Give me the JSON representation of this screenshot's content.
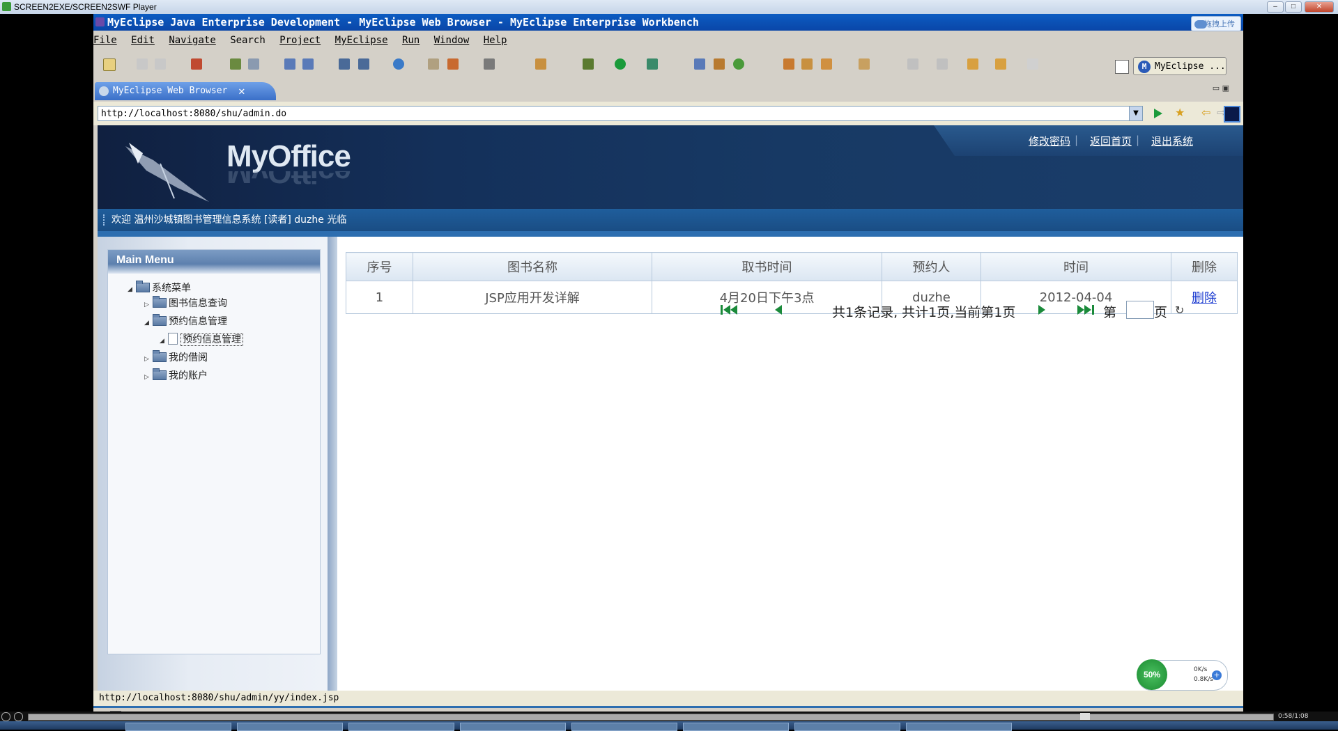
{
  "player": {
    "title": "SCREEN2EXE/SCREEN2SWF Player",
    "time": "0:58/1:08"
  },
  "eclipse": {
    "title": "MyEclipse Java Enterprise Development - MyEclipse Web Browser - MyEclipse Enterprise Workbench",
    "upload_label": "拖拽上传",
    "menus": [
      "File",
      "Edit",
      "Navigate",
      "Search",
      "Project",
      "MyEclipse",
      "Run",
      "Window",
      "Help"
    ],
    "perspective": "MyEclipse ...",
    "perspective_icon_letter": "M",
    "tab_label": "MyEclipse Web Browser",
    "url": "http://localhost:8080/shu/admin.do",
    "status_url": "http://localhost:8080/shu/admin/yy/index.jsp"
  },
  "site": {
    "logo": "MyOffice",
    "top_links": [
      "修改密码",
      "返回首页",
      "退出系统"
    ],
    "welcome": "欢迎 温州沙城镇图书管理信息系统 [读者] duzhe 光临"
  },
  "sidebar": {
    "title": "Main Menu",
    "root": "系统菜单",
    "items": [
      "图书信息查询",
      "预约信息管理",
      "预约信息管理",
      "我的借阅",
      "我的账户"
    ]
  },
  "table": {
    "headers": [
      "序号",
      "图书名称",
      "取书时间",
      "预约人",
      "时间",
      "删除"
    ],
    "rows": [
      {
        "no": "1",
        "book": "JSP应用开发详解",
        "pickup": "4月20日下午3点",
        "reserver": "duzhe",
        "time": "2012-04-04",
        "action": "删除"
      }
    ]
  },
  "pager": {
    "summary": "共1条记录, 共计1页,当前第1页",
    "di": "第",
    "ye": "页"
  },
  "network": {
    "percent": "50%",
    "up": "0K/s",
    "down": "0.8K/s"
  },
  "colors": {
    "title_blue": "#0a46a8",
    "banner": "#14305a",
    "welcome_bar": "#1f5e9c",
    "link": "#1a3ad0"
  }
}
